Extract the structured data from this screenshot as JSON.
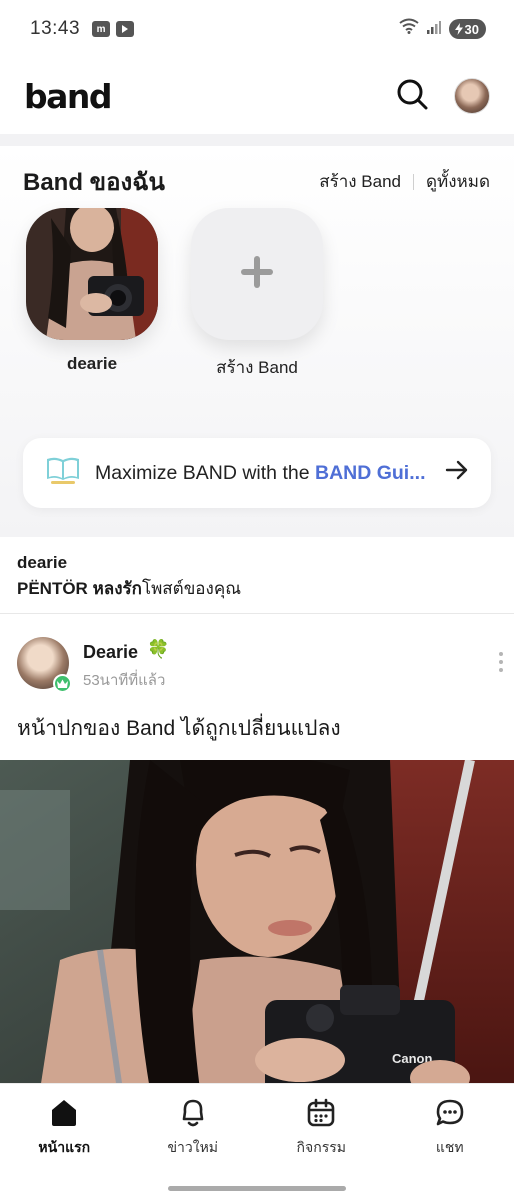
{
  "status_bar": {
    "time": "13:43",
    "battery": "30",
    "app_icons": [
      "m-app-icon",
      "youtube-icon"
    ]
  },
  "header": {
    "logo": "band",
    "search_icon": "search-icon",
    "profile_icon": "profile-avatar"
  },
  "my_bands": {
    "title": "Band ของฉัน",
    "create_link": "สร้าง Band",
    "view_all_link": "ดูทั้งหมด",
    "bands": [
      {
        "name": "dearie"
      }
    ],
    "create_tile_label": "สร้าง Band"
  },
  "guide_banner": {
    "text_prefix": "Maximize BAND with the ",
    "text_highlight": "BAND Gui...",
    "icon": "book-icon",
    "accent_color": "#4f6fd6"
  },
  "notification": {
    "band_name": "dearie",
    "actor": "PËNTÖR",
    "action": "หลงรัก",
    "suffix": "โพสต์ของคุณ"
  },
  "post": {
    "author": "Dearie",
    "author_badge": "clover-icon",
    "time": "53นาทีที่แล้ว",
    "text": "หน้าปกของ Band ได้ถูกเปลี่ยนแปลง"
  },
  "bottom_nav": {
    "items": [
      {
        "label": "หน้าแรก",
        "icon": "home-icon",
        "active": true
      },
      {
        "label": "ข่าวใหม่",
        "icon": "bell-icon",
        "active": false
      },
      {
        "label": "กิจกรรม",
        "icon": "calendar-icon",
        "active": false
      },
      {
        "label": "แชท",
        "icon": "chat-icon",
        "active": false
      }
    ]
  }
}
